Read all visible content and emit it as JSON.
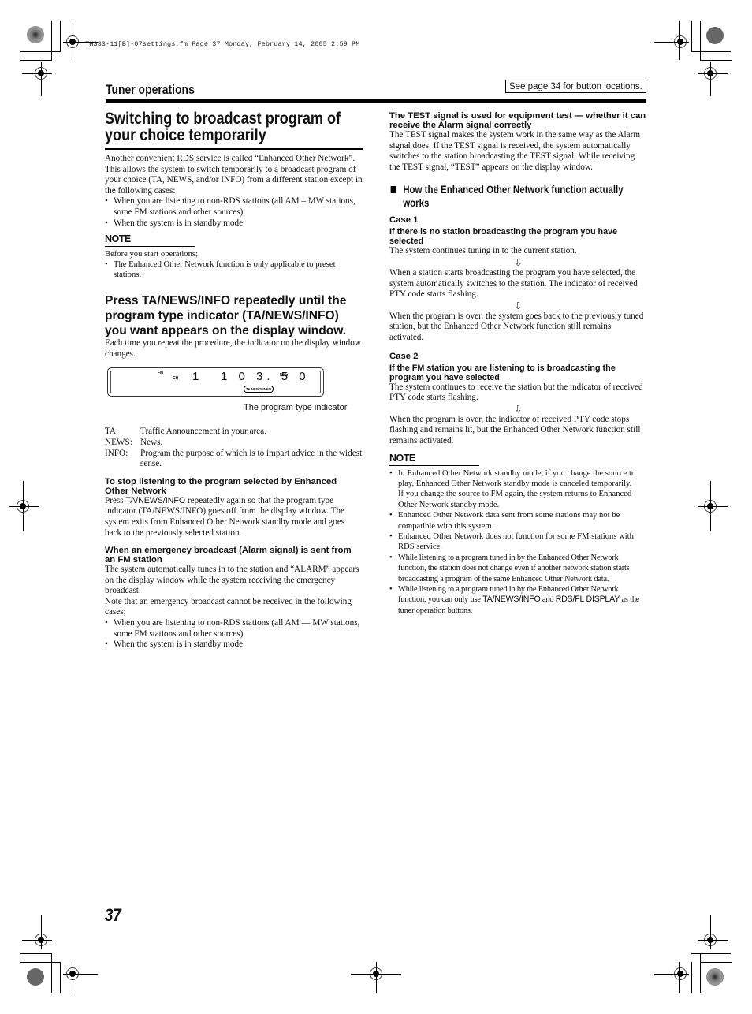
{
  "print_slug": "THS33-11[B]-07settings.fm  Page 37  Monday, February 14, 2005  2:59 PM",
  "section_title": "Tuner operations",
  "reference_box": "See page 34 for button locations.",
  "left": {
    "heading": "Switching to broadcast program of your choice temporarily",
    "intro_1": "Another convenient RDS service is called “Enhanced Other Network”.",
    "intro_2": "This allows the system to switch temporarily to a broadcast program of your choice (TA, NEWS, and/or INFO) from a different station except in the following cases:",
    "cases": [
      "When you are listening to non-RDS stations (all AM – MW stations, some FM stations and other sources).",
      "When the system is in standby mode."
    ],
    "note_label": "NOTE",
    "note_intro": "Before you start operations;",
    "note_items": [
      "The Enhanced Other Network function is only applicable to preset stations."
    ],
    "step_heading": "Press TA/NEWS/INFO repeatedly until the program type indicator (TA/NEWS/INFO) you want appears on the display window.",
    "step_body": "Each time you repeat the procedure, the indicator on the display window changes.",
    "display": {
      "band": "FM",
      "ch_label": "CH",
      "channel": "1",
      "frequency": "1 0 3. 5 0",
      "unit": "MHz",
      "pty_indicator": "TA NEWS INFO",
      "caption": "The program type indicator"
    },
    "definitions": [
      {
        "term": "TA:",
        "desc": "Traffic Announcement in your area."
      },
      {
        "term": "NEWS:",
        "desc": "News."
      },
      {
        "term": "INFO:",
        "desc": "Program the purpose of which is to impart advice in the widest sense."
      }
    ],
    "stop_heading": "To stop listening to the program selected by Enhanced Other Network",
    "stop_body_pre": "Press ",
    "stop_body_button": "TA/NEWS/INFO",
    "stop_body_post": " repeatedly again so that the program type indicator (TA/NEWS/INFO) goes off from the display window. The system exits from Enhanced Other Network standby mode and goes back to the previously selected station.",
    "alarm_heading": "When an emergency broadcast (Alarm signal) is sent from an FM station",
    "alarm_body_1": "The system automatically tunes in to the station and “ALARM” appears on the display window while the system receiving the emergency broadcast.",
    "alarm_body_2": "Note that an emergency broadcast cannot be received in the following cases;",
    "alarm_cases": [
      "When you are listening to non-RDS stations (all AM — MW stations, some FM stations and other sources).",
      "When the system is in standby mode."
    ]
  },
  "right": {
    "test_heading": "The TEST signal is used for equipment test — whether it can receive the Alarm signal correctly",
    "test_body": "The TEST signal makes the system work in the same way as the Alarm signal does. If the TEST signal is received, the system automatically switches to the station broadcasting the TEST signal. While receiving the TEST signal, “TEST” appears on the display window.",
    "how_heading": "How the Enhanced Other Network function actually works",
    "case1_label": "Case 1",
    "case1_heading": "If there is no station broadcasting the program you have selected",
    "case1_steps": [
      "The system continues tuning in to the current station.",
      "When a station starts broadcasting the program you have selected, the system automatically switches to the station. The indicator of received PTY code starts flashing.",
      "When the program is over, the system goes back to the previously tuned station, but the Enhanced Other Network function still remains activated."
    ],
    "case2_label": "Case 2",
    "case2_heading": "If the FM station you are listening to is broadcasting the program you have selected",
    "case2_steps": [
      "The system continues to receive the station but the indicator of received PTY code starts flashing.",
      "When the program is over, the indicator of received PTY code stops flashing and remains lit, but the Enhanced Other Network function still remains activated."
    ],
    "arrow": "⇩",
    "note_label": "NOTE",
    "note_items": [
      "In Enhanced Other Network standby mode, if you change the source to play, Enhanced Other Network standby mode is canceled temporarily.",
      "Enhanced Other Network data sent from some stations may not be compatible with this system.",
      "Enhanced Other Network does not function for some FM stations with RDS service.",
      "While listening to a program tuned in by the Enhanced Other Network function, the station does not change even if another network station starts broadcasting a program of the same Enhanced Other Network data."
    ],
    "note_item1_extra": "If you change the source to FM again, the system returns to Enhanced Other Network standby mode.",
    "note_last_pre": "While listening to a program tuned in by the Enhanced Other Network function, you can only use ",
    "note_last_btn1": "TA/NEWS/INFO",
    "note_last_mid": " and ",
    "note_last_btn2": "RDS/FL DISPLAY",
    "note_last_post": " as the tuner operation buttons."
  },
  "page_number": "37"
}
